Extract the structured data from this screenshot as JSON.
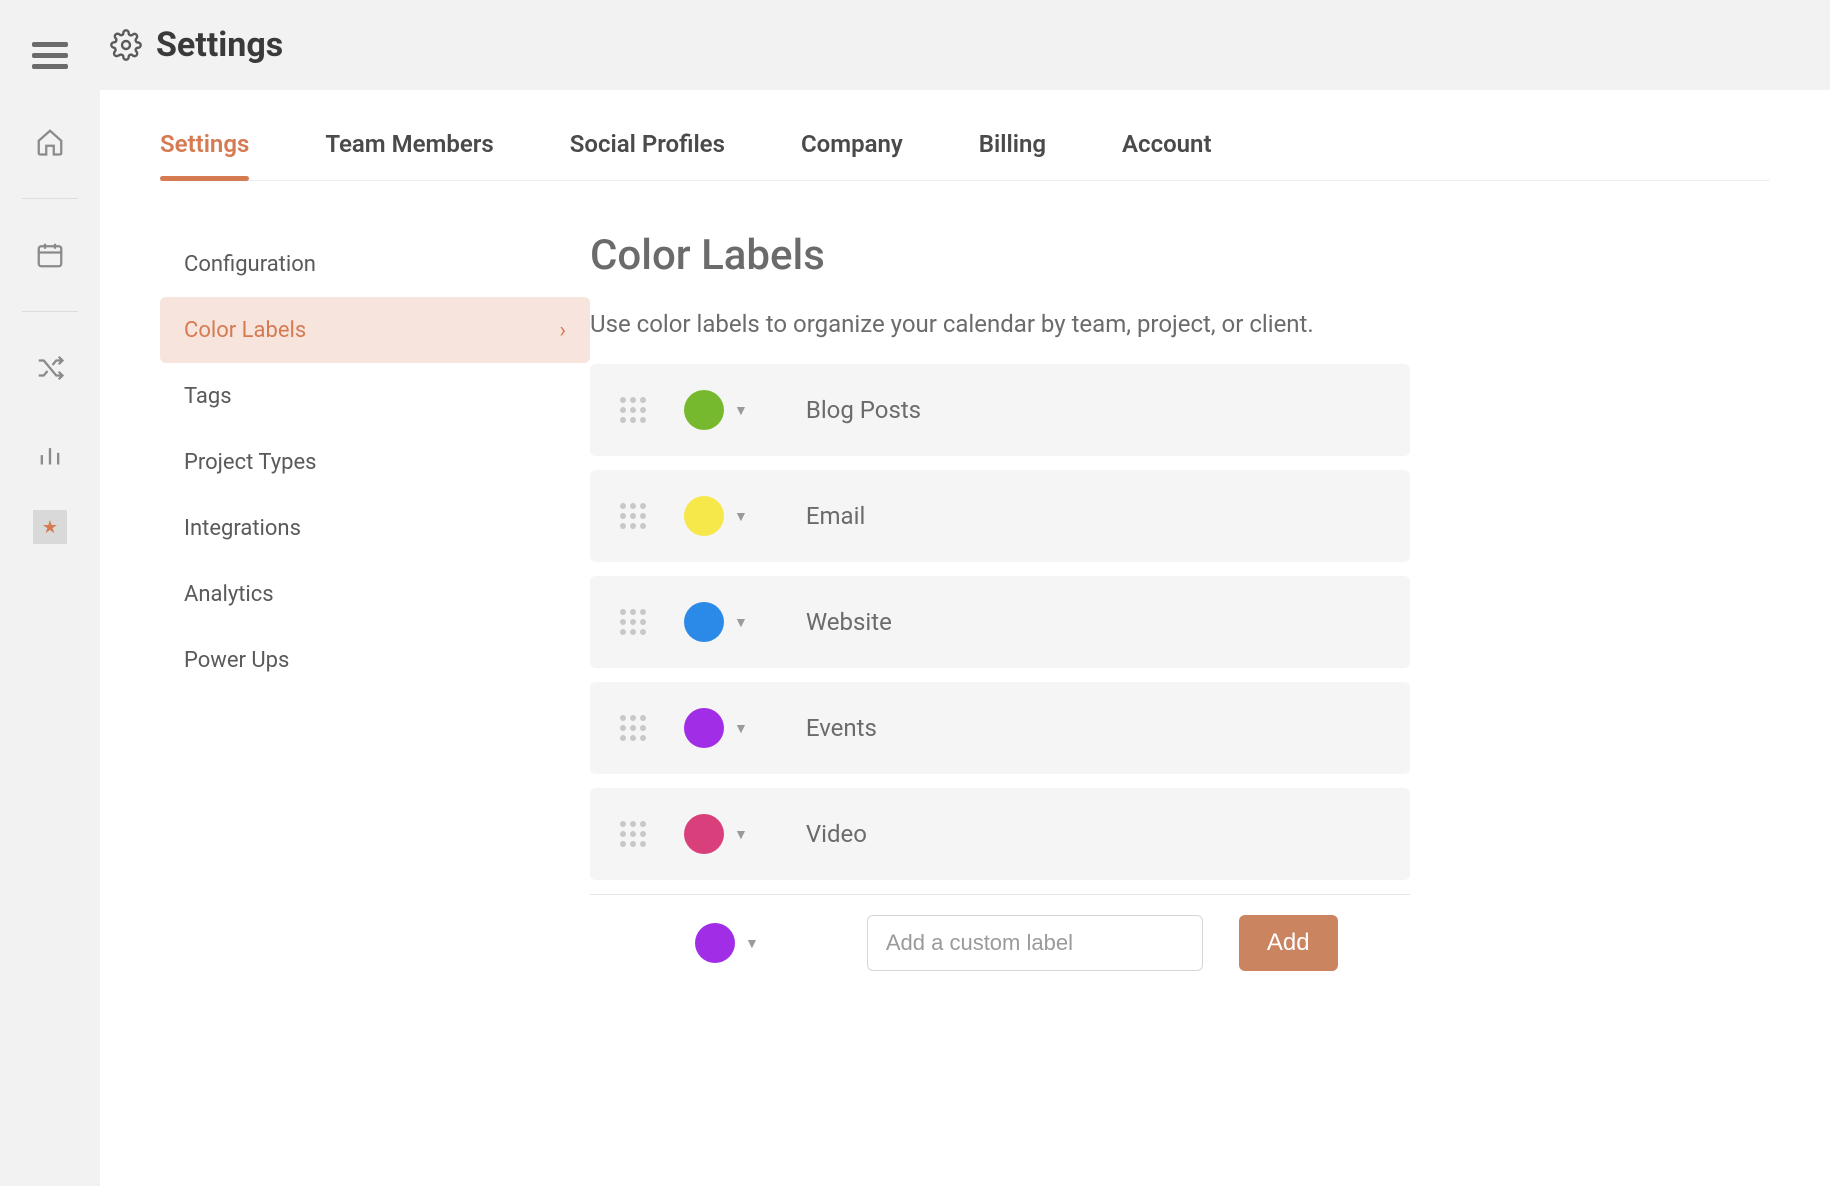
{
  "header": {
    "title": "Settings"
  },
  "tabs": [
    {
      "label": "Settings",
      "active": true
    },
    {
      "label": "Team Members",
      "active": false
    },
    {
      "label": "Social Profiles",
      "active": false
    },
    {
      "label": "Company",
      "active": false
    },
    {
      "label": "Billing",
      "active": false
    },
    {
      "label": "Account",
      "active": false
    }
  ],
  "sidebar": {
    "items": [
      {
        "label": "Configuration",
        "active": false
      },
      {
        "label": "Color Labels",
        "active": true
      },
      {
        "label": "Tags",
        "active": false
      },
      {
        "label": "Project Types",
        "active": false
      },
      {
        "label": "Integrations",
        "active": false
      },
      {
        "label": "Analytics",
        "active": false
      },
      {
        "label": "Power Ups",
        "active": false
      }
    ]
  },
  "page": {
    "title": "Color Labels",
    "description": "Use color labels to organize your calendar by team, project, or client."
  },
  "labels": [
    {
      "name": "Blog Posts",
      "color": "#77b92e"
    },
    {
      "name": "Email",
      "color": "#f6e84a"
    },
    {
      "name": "Website",
      "color": "#2b89e8"
    },
    {
      "name": "Events",
      "color": "#a12de6"
    },
    {
      "name": "Video",
      "color": "#d93f7b"
    }
  ],
  "new_label": {
    "color": "#a12de6",
    "placeholder": "Add a custom label",
    "button": "Add"
  },
  "colors": {
    "accent": "#d67a52",
    "button": "#ca8460"
  }
}
